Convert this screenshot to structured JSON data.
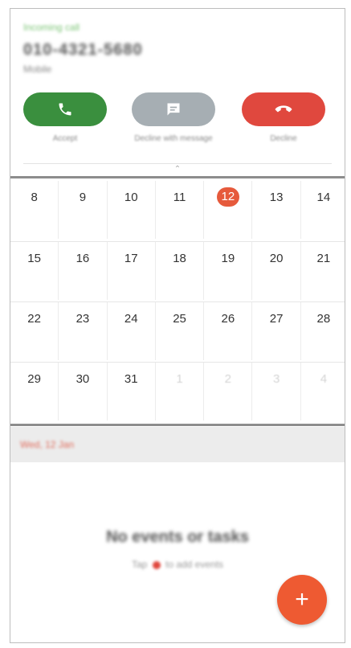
{
  "call": {
    "status": "Incoming call",
    "number": "010-4321-5680",
    "sub": "Mobile",
    "accept_label": "Accept",
    "message_label": "Decline with message",
    "decline_label": "Decline"
  },
  "calendar": {
    "weeks": [
      [
        {
          "d": "8"
        },
        {
          "d": "9"
        },
        {
          "d": "10"
        },
        {
          "d": "11"
        },
        {
          "d": "12",
          "today": true
        },
        {
          "d": "13"
        },
        {
          "d": "14"
        }
      ],
      [
        {
          "d": "15"
        },
        {
          "d": "16"
        },
        {
          "d": "17"
        },
        {
          "d": "18"
        },
        {
          "d": "19"
        },
        {
          "d": "20"
        },
        {
          "d": "21"
        }
      ],
      [
        {
          "d": "22"
        },
        {
          "d": "23"
        },
        {
          "d": "24"
        },
        {
          "d": "25"
        },
        {
          "d": "26"
        },
        {
          "d": "27"
        },
        {
          "d": "28"
        }
      ],
      [
        {
          "d": "29"
        },
        {
          "d": "30"
        },
        {
          "d": "31"
        },
        {
          "d": "1",
          "muted": true
        },
        {
          "d": "2",
          "muted": true
        },
        {
          "d": "3",
          "muted": true
        },
        {
          "d": "4",
          "muted": true
        }
      ]
    ]
  },
  "agenda": {
    "date_label": "Wed, 12 Jan",
    "empty_title": "No events or tasks",
    "empty_sub_before": "Tap",
    "empty_sub_after": "to add events"
  },
  "colors": {
    "accept": "#3a8f3e",
    "message": "#a6aeb3",
    "decline": "#e0483e",
    "today": "#e65a3c",
    "fab": "#ee5a32"
  },
  "icons": {
    "accept": "phone-icon",
    "message": "message-icon",
    "decline": "hang-up-icon",
    "fab": "add-icon"
  }
}
